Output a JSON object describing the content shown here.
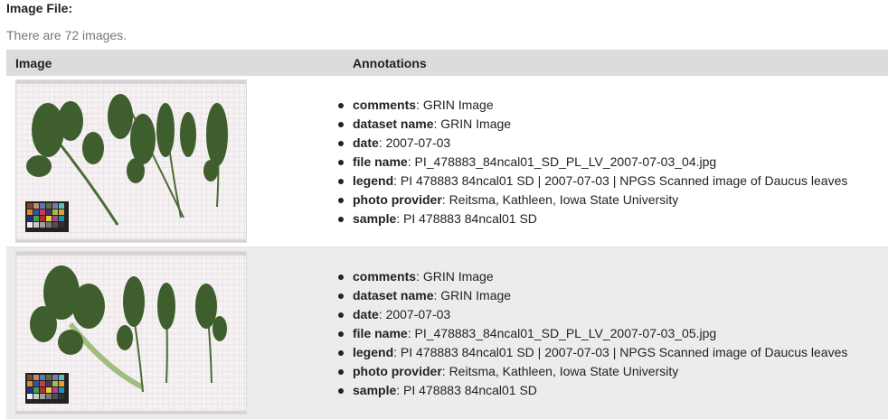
{
  "page": {
    "heading": "Image File:",
    "count_text": "There are 72 images."
  },
  "table": {
    "columns": [
      "Image",
      "Annotations"
    ],
    "rows": [
      {
        "annotations": [
          {
            "key": "comments",
            "value": "GRIN Image"
          },
          {
            "key": "dataset name",
            "value": "GRIN Image"
          },
          {
            "key": "date",
            "value": "2007-07-03"
          },
          {
            "key": "file name",
            "value": "PI_478883_84ncal01_SD_PL_LV_2007-07-03_04.jpg"
          },
          {
            "key": "legend",
            "value": "PI 478883 84ncal01 SD | 2007-07-03 | NPGS Scanned image of Daucus leaves"
          },
          {
            "key": "photo provider",
            "value": "Reitsma, Kathleen, Iowa State University"
          },
          {
            "key": "sample",
            "value": "PI 478883 84ncal01 SD"
          }
        ]
      },
      {
        "annotations": [
          {
            "key": "comments",
            "value": "GRIN Image"
          },
          {
            "key": "dataset name",
            "value": "GRIN Image"
          },
          {
            "key": "date",
            "value": "2007-07-03"
          },
          {
            "key": "file name",
            "value": "PI_478883_84ncal01_SD_PL_LV_2007-07-03_05.jpg"
          },
          {
            "key": "legend",
            "value": "PI 478883 84ncal01 SD | 2007-07-03 | NPGS Scanned image of Daucus leaves"
          },
          {
            "key": "photo provider",
            "value": "Reitsma, Kathleen, Iowa State University"
          },
          {
            "key": "sample",
            "value": "PI 478883 84ncal01 SD"
          }
        ]
      }
    ]
  },
  "colors": {
    "header_bg": "#dcdcdc",
    "alt_row_bg": "#ececec",
    "leaf_green": "#3e5e2e"
  },
  "icons": {
    "thumbnail": "leaf-scan-thumbnail"
  }
}
